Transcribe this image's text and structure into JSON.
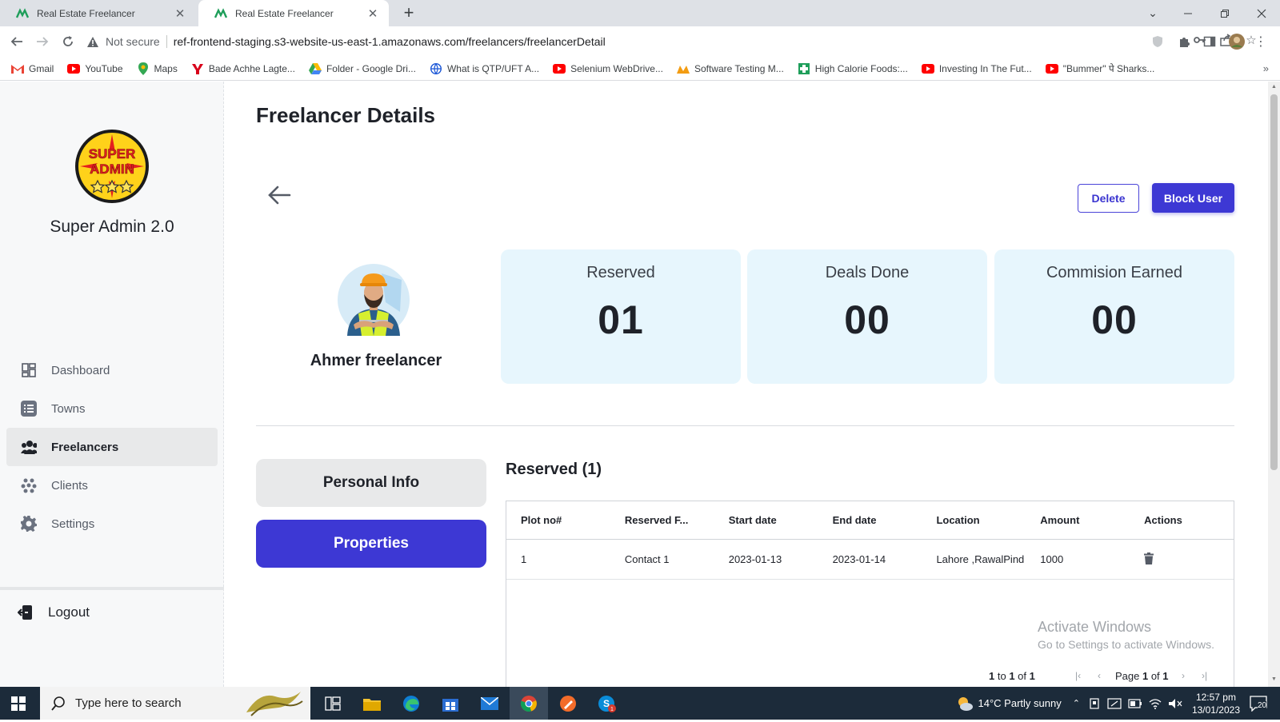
{
  "browser": {
    "tabs": [
      {
        "title": "Real Estate Freelancer",
        "active": false
      },
      {
        "title": "Real Estate Freelancer",
        "active": true
      }
    ],
    "security_label": "Not secure",
    "url": "ref-frontend-staging.s3-website-us-east-1.amazonaws.com/freelancers/freelancerDetail",
    "bookmarks": [
      {
        "label": "Gmail",
        "icon": "gmail-icon"
      },
      {
        "label": "YouTube",
        "icon": "youtube-icon"
      },
      {
        "label": "Maps",
        "icon": "maps-icon"
      },
      {
        "label": "Bade Achhe Lagte...",
        "icon": "yahoo-icon"
      },
      {
        "label": "Folder - Google Dri...",
        "icon": "drive-icon"
      },
      {
        "label": "What is QTP/UFT A...",
        "icon": "globe-icon"
      },
      {
        "label": "Selenium WebDrive...",
        "icon": "youtube-icon"
      },
      {
        "label": "Software Testing M...",
        "icon": "guru-icon"
      },
      {
        "label": "High Calorie Foods:...",
        "icon": "health-icon"
      },
      {
        "label": "Investing In The Fut...",
        "icon": "youtube-icon"
      },
      {
        "label": "\"Bummer\" पे Sharks...",
        "icon": "youtube-icon"
      }
    ]
  },
  "sidebar": {
    "brand": "Super Admin 2.0",
    "logo_text": "SUPER ADMIN",
    "items": [
      {
        "label": "Dashboard",
        "icon": "dashboard-icon",
        "active": false
      },
      {
        "label": "Towns",
        "icon": "list-icon",
        "active": false
      },
      {
        "label": "Freelancers",
        "icon": "users-icon",
        "active": true
      },
      {
        "label": "Clients",
        "icon": "clients-icon",
        "active": false
      },
      {
        "label": "Settings",
        "icon": "gear-icon",
        "active": false
      }
    ],
    "logout": "Logout"
  },
  "main": {
    "title": "Freelancer Details",
    "delete_label": "Delete",
    "block_label": "Block User",
    "profile_name": "Ahmer freelancer",
    "stats": [
      {
        "label": "Reserved",
        "value": "01"
      },
      {
        "label": "Deals Done",
        "value": "00"
      },
      {
        "label": "Commision Earned",
        "value": "00"
      }
    ],
    "side_tabs": {
      "info": "Personal Info",
      "properties": "Properties"
    },
    "section_title": "Reserved (1)",
    "table": {
      "columns": [
        "Plot no#",
        "Reserved F...",
        "Start date",
        "End date",
        "Location",
        "Amount",
        "Actions"
      ],
      "rows": [
        {
          "plot": "1",
          "reserved_for": "Contact 1",
          "start": "2023-01-13",
          "end": "2023-01-14",
          "location": "Lahore ,RawalPind",
          "amount": "1000"
        }
      ]
    },
    "pager": {
      "range_from": "1",
      "range_to": "1",
      "total": "1",
      "page": "1",
      "pages": "1"
    }
  },
  "watermark": {
    "line1": "Activate Windows",
    "line2": "Go to Settings to activate Windows."
  },
  "taskbar": {
    "search_placeholder": "Type here to search",
    "weather": "14°C  Partly sunny",
    "time": "12:57 pm",
    "date": "13/01/2023",
    "notifications": "20"
  },
  "colors": {
    "primary": "#3d38d4",
    "card_bg": "#e7f6fd",
    "sidebar_bg": "#f7f8f9"
  }
}
